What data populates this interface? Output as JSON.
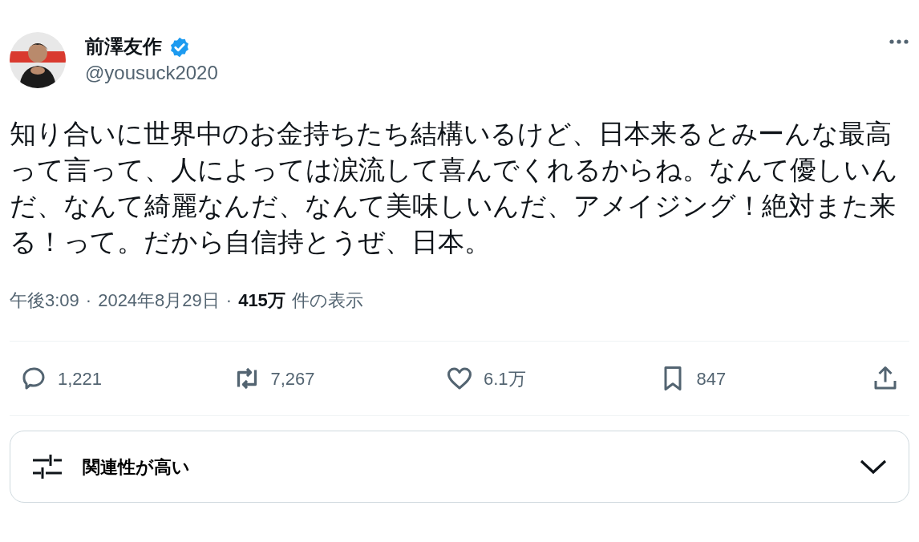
{
  "author": {
    "name": "前澤友作",
    "verified": true,
    "handle": "@yousuck2020"
  },
  "text": "知り合いに世界中のお金持ちたち結構いるけど、日本来るとみーんな最高って言って、人によっては涙流して喜んでくれるからね。なんて優しいんだ、なんて綺麗なんだ、なんて美味しいんだ、アメイジング！絶対また来る！って。だから自信持とうぜ、日本。",
  "meta": {
    "time": "午後3:09",
    "separator": "·",
    "date": "2024年8月29日",
    "views": "415万",
    "views_label": "件の表示"
  },
  "actions": [
    {
      "kind": "reply",
      "count": "1,221"
    },
    {
      "kind": "repost",
      "count": "7,267"
    },
    {
      "kind": "like",
      "count": "6.1万"
    },
    {
      "kind": "bookmark",
      "count": "847"
    },
    {
      "kind": "share"
    }
  ],
  "sort": {
    "label": "関連性が高い"
  }
}
